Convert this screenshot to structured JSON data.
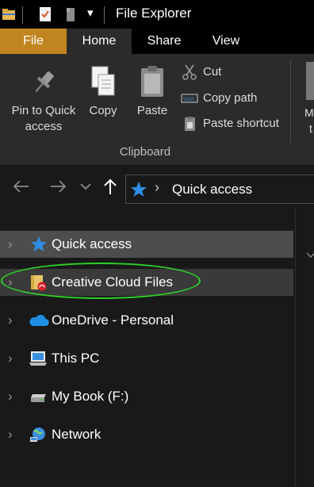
{
  "window": {
    "title": "File Explorer"
  },
  "quick_access_toolbar": [
    {
      "icon": "folder-icon"
    },
    {
      "icon": "properties-icon"
    },
    {
      "icon": "new-folder-icon"
    },
    {
      "icon": "customize-dropdown-icon",
      "glyph": "▾"
    }
  ],
  "tabs": [
    {
      "label": "File",
      "active": false
    },
    {
      "label": "Home",
      "active": true
    },
    {
      "label": "Share",
      "active": false
    },
    {
      "label": "View",
      "active": false
    }
  ],
  "ribbon": {
    "pin_label_line1": "Pin to Quick",
    "pin_label_line2": "access",
    "copy_label": "Copy",
    "paste_label": "Paste",
    "cut_label": "Cut",
    "copy_path_label": "Copy path",
    "paste_shortcut_label": "Paste shortcut",
    "group_label": "Clipboard",
    "next_label_line1": "M",
    "next_label_line2": "t"
  },
  "address": {
    "location": "Quick access",
    "separator": "›"
  },
  "nav_pane": {
    "items": [
      {
        "label": "Quick access",
        "icon": "star-icon",
        "state": "selected"
      },
      {
        "label": "Creative Cloud Files",
        "icon": "creative-cloud-folder-icon",
        "state": "hover"
      },
      {
        "label": "OneDrive - Personal",
        "icon": "onedrive-cloud-icon",
        "state": "normal"
      },
      {
        "label": "This PC",
        "icon": "this-pc-icon",
        "state": "normal"
      },
      {
        "label": "My Book (F:)",
        "icon": "drive-icon",
        "state": "normal"
      },
      {
        "label": "Network",
        "icon": "network-icon",
        "state": "normal"
      }
    ],
    "expand_glyph": "›"
  },
  "colors": {
    "file_tab": "#c1851f",
    "highlight_ring": "#2ed02a",
    "star_blue": "#2d8fe6"
  }
}
